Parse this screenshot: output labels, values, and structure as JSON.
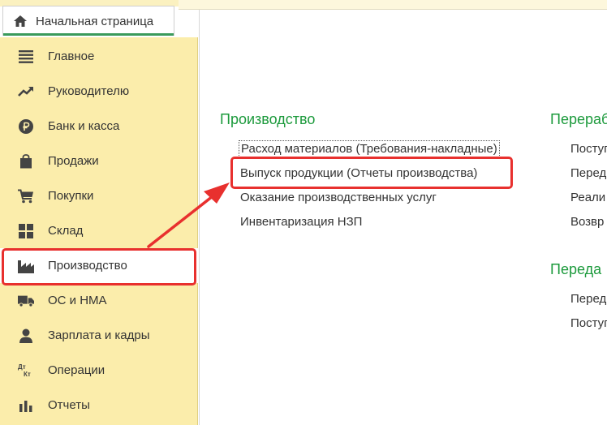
{
  "home_tab": {
    "label": "Начальная страница",
    "icon": "home-icon"
  },
  "sidebar": {
    "items": [
      {
        "label": "Главное",
        "icon": "menu-lines-icon"
      },
      {
        "label": "Руководителю",
        "icon": "trend-up-icon"
      },
      {
        "label": "Банк и касса",
        "icon": "ruble-coin-icon"
      },
      {
        "label": "Продажи",
        "icon": "shopping-bag-icon"
      },
      {
        "label": "Покупки",
        "icon": "cart-icon"
      },
      {
        "label": "Склад",
        "icon": "warehouse-icon"
      },
      {
        "label": "Производство",
        "icon": "factory-icon",
        "active": true
      },
      {
        "label": "ОС и НМА",
        "icon": "truck-icon"
      },
      {
        "label": "Зарплата и кадры",
        "icon": "person-icon"
      },
      {
        "label": "Операции",
        "icon": "debit-credit-icon",
        "icon_text_top": "Дт",
        "icon_text_bottom": "Кт"
      },
      {
        "label": "Отчеты",
        "icon": "bar-chart-icon"
      }
    ]
  },
  "main": {
    "production": {
      "title": "Производство",
      "links": [
        "Расход материалов (Требования-накладные)",
        "Выпуск продукции (Отчеты производства)",
        "Оказание производственных услуг",
        "Инвентаризация НЗП"
      ]
    },
    "processing_received": {
      "title": "Переработ",
      "links": [
        "Поступ",
        "Перед",
        "Реали",
        "Возвр"
      ]
    },
    "processing_given": {
      "title": "Переда",
      "links": [
        "Перед",
        "Поступ"
      ]
    }
  },
  "colors": {
    "sidebar_bg": "#fbedab",
    "section_title": "#1c9a3c",
    "highlight": "#e8302e",
    "active_tab_underline": "#3a9a5b"
  }
}
